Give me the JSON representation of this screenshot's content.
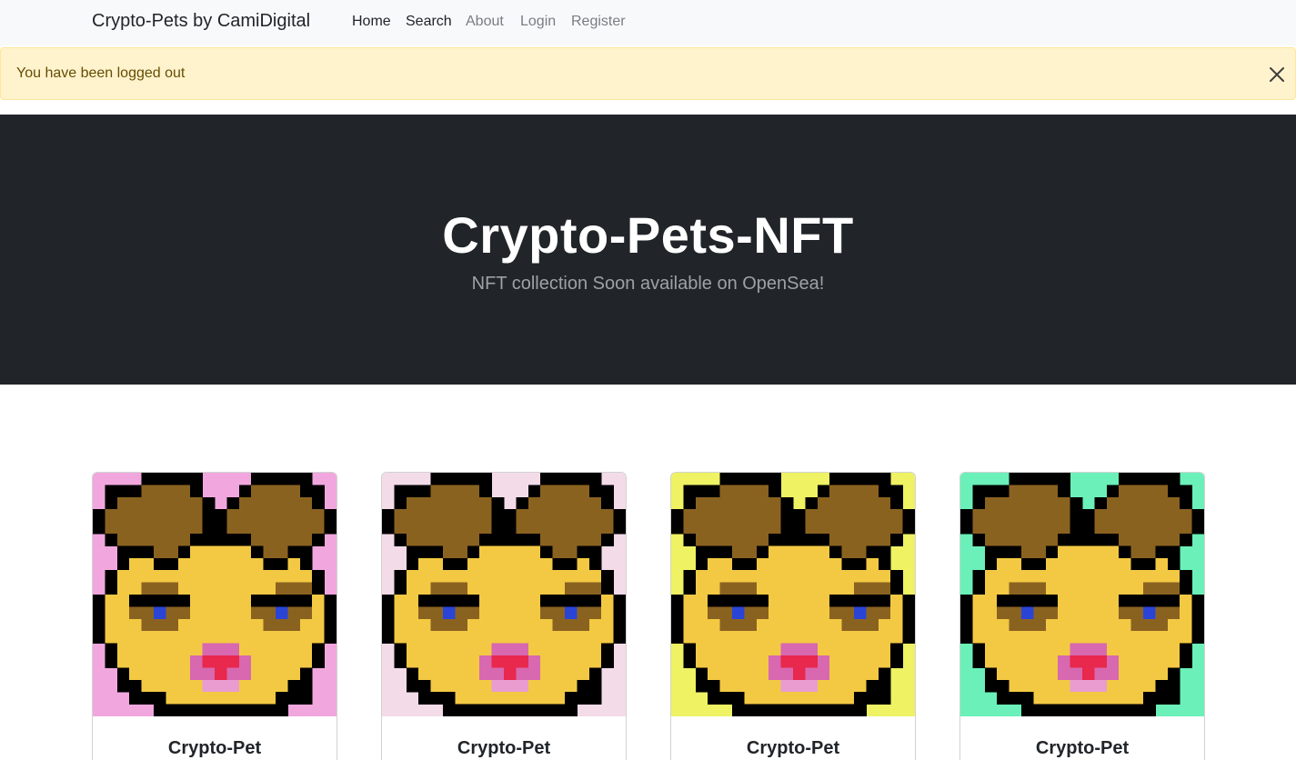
{
  "navbar": {
    "brand": "Crypto-Pets by CamiDigital",
    "links": [
      {
        "label": "Home"
      },
      {
        "label": "Search"
      },
      {
        "label": "About"
      },
      {
        "label": "Login"
      },
      {
        "label": "Register"
      }
    ]
  },
  "alert": {
    "message": "You have been logged out",
    "close_icon": "close-icon"
  },
  "hero": {
    "title": "Crypto-Pets-NFT",
    "subtitle": "NFT collection Soon available on OpenSea!"
  },
  "cards": [
    {
      "title": "Crypto-Pet",
      "background": "#f1a7dd"
    },
    {
      "title": "Crypto-Pet",
      "background": "#f3dbe8"
    },
    {
      "title": "Crypto-Pet",
      "background": "#eef263"
    },
    {
      "title": "Crypto-Pet",
      "background": "#6af0b8"
    }
  ],
  "colors": {
    "navbar_bg": "#f8f9fa",
    "alert_bg": "#fff3cd",
    "alert_text": "#664d03",
    "hero_bg": "#212529",
    "pet_face": "#f3c943",
    "pet_ears": "#8a6220",
    "pet_eye": "#2a45d6",
    "pet_nose": "#e8284c"
  }
}
